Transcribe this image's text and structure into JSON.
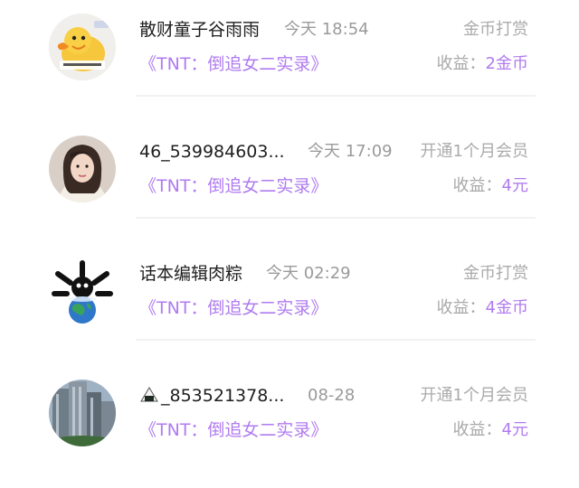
{
  "colors": {
    "accent": "#b07bf0",
    "name_text": "#1e1e1e",
    "secondary_text": "#9a9a9a",
    "divider": "#f2f2f4"
  },
  "records": [
    {
      "avatar": "duck-avatar-icon",
      "name": "散财童子谷雨雨",
      "time": "今天 18:54",
      "type": "金币打赏",
      "work": "《TNT：倒追女二实录》",
      "earnings_label": "收益：",
      "earnings_value": "2金币"
    },
    {
      "avatar": "girl-portrait-avatar",
      "name": "46_539984603...",
      "time": "今天 17:09",
      "type": "开通1个月会员",
      "work": "《TNT：倒追女二实录》",
      "earnings_label": "收益：",
      "earnings_value": "4元"
    },
    {
      "avatar": "cartoon-earth-avatar",
      "name": "话本编辑肉粽",
      "time": "今天 02:29",
      "type": "金币打赏",
      "work": "《TNT：倒追女二实录》",
      "earnings_label": "收益：",
      "earnings_value": "4金币"
    },
    {
      "avatar": "building-photo-avatar",
      "name_icon": "rice-ball-icon",
      "name": "_853521378...",
      "time": "08-28",
      "type": "开通1个月会员",
      "work": "《TNT：倒追女二实录》",
      "earnings_label": "收益：",
      "earnings_value": "4元"
    }
  ]
}
